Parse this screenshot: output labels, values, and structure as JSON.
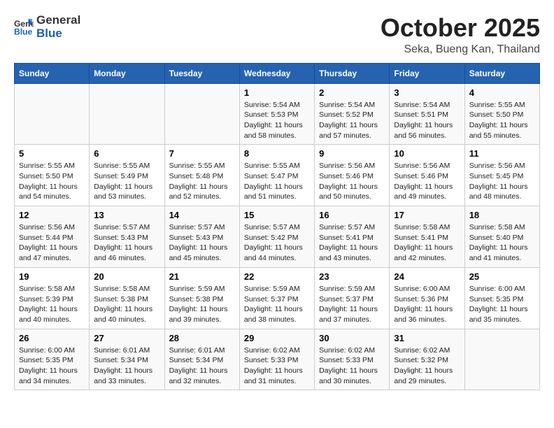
{
  "header": {
    "logo_general": "General",
    "logo_blue": "Blue",
    "month": "October 2025",
    "location": "Seka, Bueng Kan, Thailand"
  },
  "weekdays": [
    "Sunday",
    "Monday",
    "Tuesday",
    "Wednesday",
    "Thursday",
    "Friday",
    "Saturday"
  ],
  "weeks": [
    [
      {
        "day": "",
        "info": ""
      },
      {
        "day": "",
        "info": ""
      },
      {
        "day": "",
        "info": ""
      },
      {
        "day": "1",
        "info": "Sunrise: 5:54 AM\nSunset: 5:53 PM\nDaylight: 11 hours\nand 58 minutes."
      },
      {
        "day": "2",
        "info": "Sunrise: 5:54 AM\nSunset: 5:52 PM\nDaylight: 11 hours\nand 57 minutes."
      },
      {
        "day": "3",
        "info": "Sunrise: 5:54 AM\nSunset: 5:51 PM\nDaylight: 11 hours\nand 56 minutes."
      },
      {
        "day": "4",
        "info": "Sunrise: 5:55 AM\nSunset: 5:50 PM\nDaylight: 11 hours\nand 55 minutes."
      }
    ],
    [
      {
        "day": "5",
        "info": "Sunrise: 5:55 AM\nSunset: 5:50 PM\nDaylight: 11 hours\nand 54 minutes."
      },
      {
        "day": "6",
        "info": "Sunrise: 5:55 AM\nSunset: 5:49 PM\nDaylight: 11 hours\nand 53 minutes."
      },
      {
        "day": "7",
        "info": "Sunrise: 5:55 AM\nSunset: 5:48 PM\nDaylight: 11 hours\nand 52 minutes."
      },
      {
        "day": "8",
        "info": "Sunrise: 5:55 AM\nSunset: 5:47 PM\nDaylight: 11 hours\nand 51 minutes."
      },
      {
        "day": "9",
        "info": "Sunrise: 5:56 AM\nSunset: 5:46 PM\nDaylight: 11 hours\nand 50 minutes."
      },
      {
        "day": "10",
        "info": "Sunrise: 5:56 AM\nSunset: 5:46 PM\nDaylight: 11 hours\nand 49 minutes."
      },
      {
        "day": "11",
        "info": "Sunrise: 5:56 AM\nSunset: 5:45 PM\nDaylight: 11 hours\nand 48 minutes."
      }
    ],
    [
      {
        "day": "12",
        "info": "Sunrise: 5:56 AM\nSunset: 5:44 PM\nDaylight: 11 hours\nand 47 minutes."
      },
      {
        "day": "13",
        "info": "Sunrise: 5:57 AM\nSunset: 5:43 PM\nDaylight: 11 hours\nand 46 minutes."
      },
      {
        "day": "14",
        "info": "Sunrise: 5:57 AM\nSunset: 5:43 PM\nDaylight: 11 hours\nand 45 minutes."
      },
      {
        "day": "15",
        "info": "Sunrise: 5:57 AM\nSunset: 5:42 PM\nDaylight: 11 hours\nand 44 minutes."
      },
      {
        "day": "16",
        "info": "Sunrise: 5:57 AM\nSunset: 5:41 PM\nDaylight: 11 hours\nand 43 minutes."
      },
      {
        "day": "17",
        "info": "Sunrise: 5:58 AM\nSunset: 5:41 PM\nDaylight: 11 hours\nand 42 minutes."
      },
      {
        "day": "18",
        "info": "Sunrise: 5:58 AM\nSunset: 5:40 PM\nDaylight: 11 hours\nand 41 minutes."
      }
    ],
    [
      {
        "day": "19",
        "info": "Sunrise: 5:58 AM\nSunset: 5:39 PM\nDaylight: 11 hours\nand 40 minutes."
      },
      {
        "day": "20",
        "info": "Sunrise: 5:58 AM\nSunset: 5:38 PM\nDaylight: 11 hours\nand 40 minutes."
      },
      {
        "day": "21",
        "info": "Sunrise: 5:59 AM\nSunset: 5:38 PM\nDaylight: 11 hours\nand 39 minutes."
      },
      {
        "day": "22",
        "info": "Sunrise: 5:59 AM\nSunset: 5:37 PM\nDaylight: 11 hours\nand 38 minutes."
      },
      {
        "day": "23",
        "info": "Sunrise: 5:59 AM\nSunset: 5:37 PM\nDaylight: 11 hours\nand 37 minutes."
      },
      {
        "day": "24",
        "info": "Sunrise: 6:00 AM\nSunset: 5:36 PM\nDaylight: 11 hours\nand 36 minutes."
      },
      {
        "day": "25",
        "info": "Sunrise: 6:00 AM\nSunset: 5:35 PM\nDaylight: 11 hours\nand 35 minutes."
      }
    ],
    [
      {
        "day": "26",
        "info": "Sunrise: 6:00 AM\nSunset: 5:35 PM\nDaylight: 11 hours\nand 34 minutes."
      },
      {
        "day": "27",
        "info": "Sunrise: 6:01 AM\nSunset: 5:34 PM\nDaylight: 11 hours\nand 33 minutes."
      },
      {
        "day": "28",
        "info": "Sunrise: 6:01 AM\nSunset: 5:34 PM\nDaylight: 11 hours\nand 32 minutes."
      },
      {
        "day": "29",
        "info": "Sunrise: 6:02 AM\nSunset: 5:33 PM\nDaylight: 11 hours\nand 31 minutes."
      },
      {
        "day": "30",
        "info": "Sunrise: 6:02 AM\nSunset: 5:33 PM\nDaylight: 11 hours\nand 30 minutes."
      },
      {
        "day": "31",
        "info": "Sunrise: 6:02 AM\nSunset: 5:32 PM\nDaylight: 11 hours\nand 29 minutes."
      },
      {
        "day": "",
        "info": ""
      }
    ]
  ]
}
